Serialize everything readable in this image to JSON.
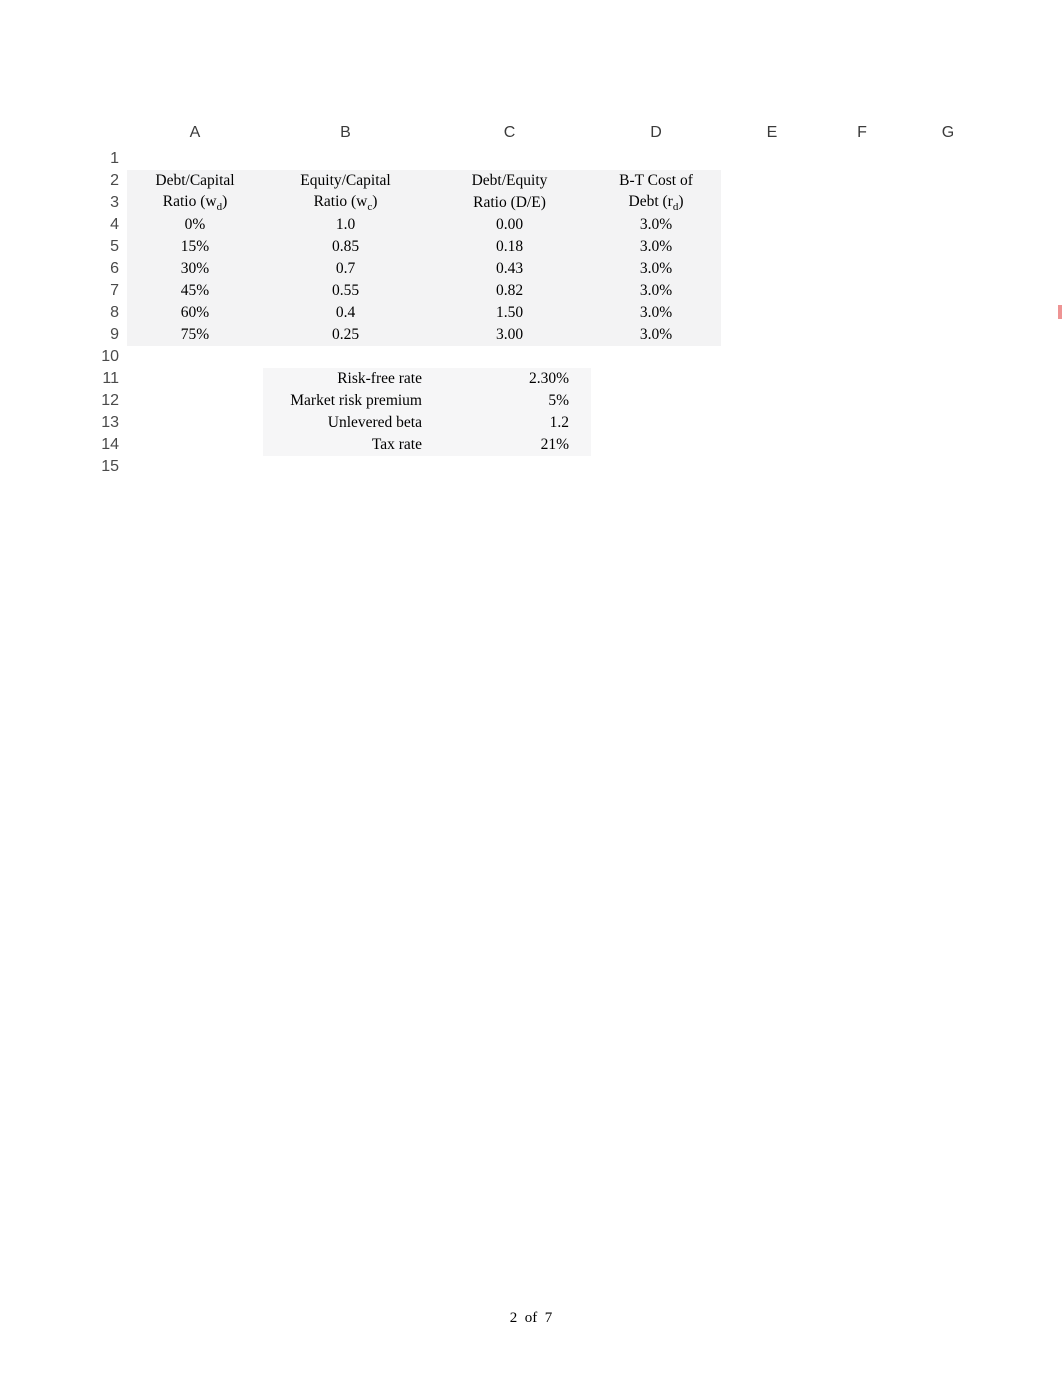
{
  "columns": [
    "A",
    "B",
    "C",
    "D",
    "E",
    "F",
    "G"
  ],
  "row_numbers": [
    "1",
    "2",
    "3",
    "4",
    "5",
    "6",
    "7",
    "8",
    "9",
    "10",
    "11",
    "12",
    "13",
    "14",
    "15"
  ],
  "headers": {
    "A_line1": "Debt/Capital",
    "A_line2_pre": "Ratio (w",
    "A_line2_sub": "d",
    "A_line2_post": ")",
    "B_line1": "Equity/Capital",
    "B_line2_pre": "Ratio (w",
    "B_line2_sub": "c",
    "B_line2_post": ")",
    "C_line1": "Debt/Equity",
    "C_line2": "Ratio (D/E)",
    "D_line1": "B-T Cost of",
    "D_line2_pre": "Debt (r",
    "D_line2_sub": "d",
    "D_line2_post": ")"
  },
  "chart_data": {
    "type": "table",
    "columns": [
      "Debt/Capital Ratio (w_d)",
      "Equity/Capital Ratio (w_c)",
      "Debt/Equity Ratio (D/E)",
      "B-T Cost of Debt (r_d)"
    ],
    "rows": [
      {
        "A": "0%",
        "B": "1.0",
        "C": "0.00",
        "D": "3.0%"
      },
      {
        "A": "15%",
        "B": "0.85",
        "C": "0.18",
        "D": "3.0%"
      },
      {
        "A": "30%",
        "B": "0.7",
        "C": "0.43",
        "D": "3.0%"
      },
      {
        "A": "45%",
        "B": "0.55",
        "C": "0.82",
        "D": "3.0%"
      },
      {
        "A": "60%",
        "B": "0.4",
        "C": "1.50",
        "D": "3.0%"
      },
      {
        "A": "75%",
        "B": "0.25",
        "C": "3.00",
        "D": "3.0%"
      }
    ],
    "assumptions": {
      "Risk-free rate": "2.30%",
      "Market risk premium": "5%",
      "Unlevered beta": "1.2",
      "Tax rate": "21%"
    }
  },
  "assumptions": [
    {
      "label": "Risk-free rate",
      "value": "2.30%"
    },
    {
      "label": "Market risk premium",
      "value": "5%"
    },
    {
      "label": "Unlevered beta",
      "value": "1.2"
    },
    {
      "label": "Tax rate",
      "value": "21%"
    }
  ],
  "footer": {
    "page": "2",
    "of_word": "of",
    "total": "7"
  }
}
